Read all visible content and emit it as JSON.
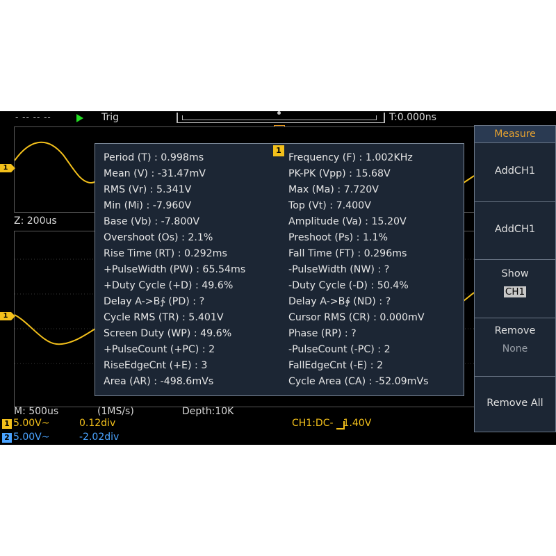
{
  "status": {
    "run_indicator": "- -- -- --",
    "trig_label": "Trig",
    "trig_time": "T:0.000ns",
    "trigger_marker": "T"
  },
  "zoom": {
    "label": "Z: 200us"
  },
  "channel_marker": "1",
  "measure": {
    "channel_badge": "1",
    "left": [
      "Period (T) : 0.998ms",
      "Mean (V) : -31.47mV",
      "RMS (Vr) : 5.341V",
      "Min (Mi) : -7.960V",
      "Base (Vb) : -7.800V",
      "Overshoot (Os) : 2.1%",
      "Rise Time (RT) : 0.292ms",
      "+PulseWidth (PW) : 65.54ms",
      "+Duty Cycle (+D) : 49.6%",
      "Delay A->B∱ (PD) :   ?",
      "Cycle RMS (TR) : 5.401V",
      "Screen Duty (WP) : 49.6%",
      "+PulseCount (+PC) : 2",
      "RiseEdgeCnt (+E) : 3",
      "Area (AR) : -498.6mVs"
    ],
    "right": [
      "Frequency (F) : 1.002KHz",
      "PK-PK (Vpp) : 15.68V",
      "Max (Ma) : 7.720V",
      "Top (Vt) : 7.400V",
      "Amplitude (Va) : 15.20V",
      "Preshoot (Ps) : 1.1%",
      "Fall Time (FT) : 0.296ms",
      "-PulseWidth (NW) :   ?",
      "-Duty Cycle (-D) : 50.4%",
      "Delay A->B∲ (ND) :   ?",
      "Cursor RMS (CR) : 0.000mV",
      "Phase (RP) :   ?",
      "-PulseCount (-PC) : 2",
      "FallEdgeCnt (-E) : 2",
      "Cycle Area (CA) : -52.09mVs"
    ]
  },
  "bottom": {
    "time_scale": "M: 500us",
    "sample_rate": "(1MS/s)",
    "depth": "Depth:10K",
    "ch1": {
      "badge": "1",
      "volt": "5.00V~",
      "pos": "0.12div"
    },
    "ch2": {
      "badge": "2",
      "volt": "5.00V~",
      "pos": "-2.02div"
    },
    "trigger": "CH1:DC-",
    "trigger_level": "1.40V"
  },
  "menu": {
    "title": "Measure",
    "addch1_a": "AddCH1",
    "addch1_b": "AddCH1",
    "show_label": "Show",
    "show_value": "CH1",
    "remove_label": "Remove",
    "remove_value": "None",
    "remove_all": "Remove All"
  },
  "colors": {
    "ch1": "#f3c01b",
    "ch2": "#4aa3ff",
    "menu_title": "#e8a330",
    "popup_bg": "#1c2634"
  }
}
